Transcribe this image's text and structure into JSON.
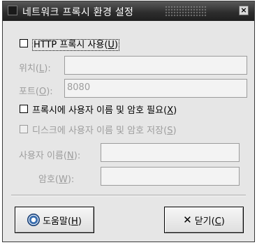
{
  "window": {
    "title": "네트워크 프록시 환경 설정",
    "close_glyph": "×"
  },
  "http_proxy": {
    "label": "HTTP 프록시 사용(",
    "mnemonic": "U",
    "label_end": ")",
    "checked": false
  },
  "location": {
    "label": "위치(",
    "mnemonic": "L",
    "label_end": "):",
    "value": ""
  },
  "port": {
    "label": "포트(",
    "mnemonic": "O",
    "label_end": "):",
    "value": "8080"
  },
  "auth_required": {
    "label": "프록시에 사용자 이름 및 암호 필요(",
    "mnemonic": "X",
    "label_end": ")",
    "checked": false
  },
  "save_to_disk": {
    "label": "디스크에 사용자 이름 및 암호 저장(",
    "mnemonic": "S",
    "label_end": ")",
    "checked": false
  },
  "username": {
    "label": "사용자 이름(",
    "mnemonic": "N",
    "label_end": "):",
    "value": ""
  },
  "password": {
    "label": "암호(",
    "mnemonic": "W",
    "label_end": "):",
    "value": ""
  },
  "buttons": {
    "help_label": "도움말(",
    "help_mnemonic": "H",
    "help_end": ")",
    "close_glyph": "✕",
    "close_label": "닫기(",
    "close_mnemonic": "C",
    "close_end": ")"
  },
  "colors": {
    "titlebar": "#2e2e2e",
    "background": "#e6e6e6",
    "disabled_text": "#9d9d9d"
  }
}
